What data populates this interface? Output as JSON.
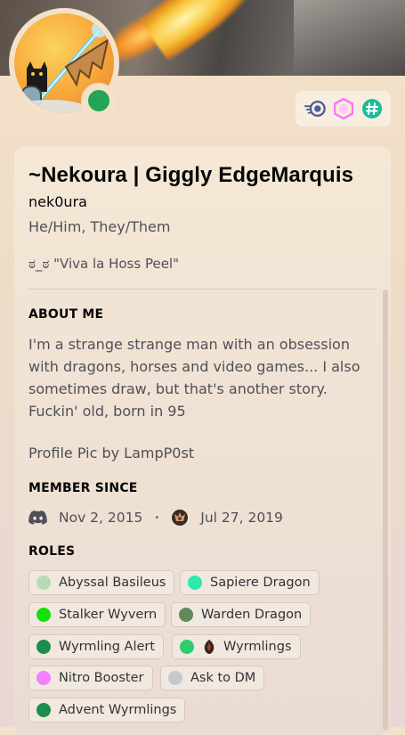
{
  "profile": {
    "display_name": "~Nekoura | Giggly EdgeMarquis",
    "username": "nek0ura",
    "pronouns": "He/Him, They/Them",
    "custom_status": "ಠ_ಠ \"Viva la Hoss Peel\"",
    "status_color": "#23a559"
  },
  "badges": [
    {
      "name": "nitro-badge",
      "color": "#5865f2"
    },
    {
      "name": "hypesquad-badge",
      "color": "#ff73fa"
    },
    {
      "name": "hash-badge",
      "color": "#1abc9c"
    }
  ],
  "about": {
    "title": "ABOUT ME",
    "lines": [
      "I'm a strange strange man with an obsession",
      "with dragons, horses and video games... I also",
      "sometimes draw, but that's another story.",
      "Fuckin' old, born in 95"
    ],
    "credit": "Profile Pic by LampP0st"
  },
  "member_since": {
    "title": "MEMBER SINCE",
    "discord_date": "Nov 2, 2015",
    "separator": "•",
    "server_date": "Jul 27, 2019"
  },
  "roles": {
    "title": "ROLES",
    "items": [
      {
        "label": "Abyssal Basileus",
        "color": "#b9d8b5"
      },
      {
        "label": "Sapiere Dragon",
        "color": "#2ee8b0"
      },
      {
        "label": "Stalker Wyvern",
        "color": "#12e007"
      },
      {
        "label": "Warden Dragon",
        "color": "#5f8a5c"
      },
      {
        "label": "Wyrmling Alert",
        "color": "#1f8b4c"
      },
      {
        "label": "Wyrmlings",
        "color": "#2ecc71"
      },
      {
        "label": "Nitro Booster",
        "color": "#f47fff"
      },
      {
        "label": "Ask to DM",
        "color": "#c4c9ce"
      },
      {
        "label": "Advent Wyrmlings",
        "color": "#1f8b4c"
      }
    ]
  }
}
